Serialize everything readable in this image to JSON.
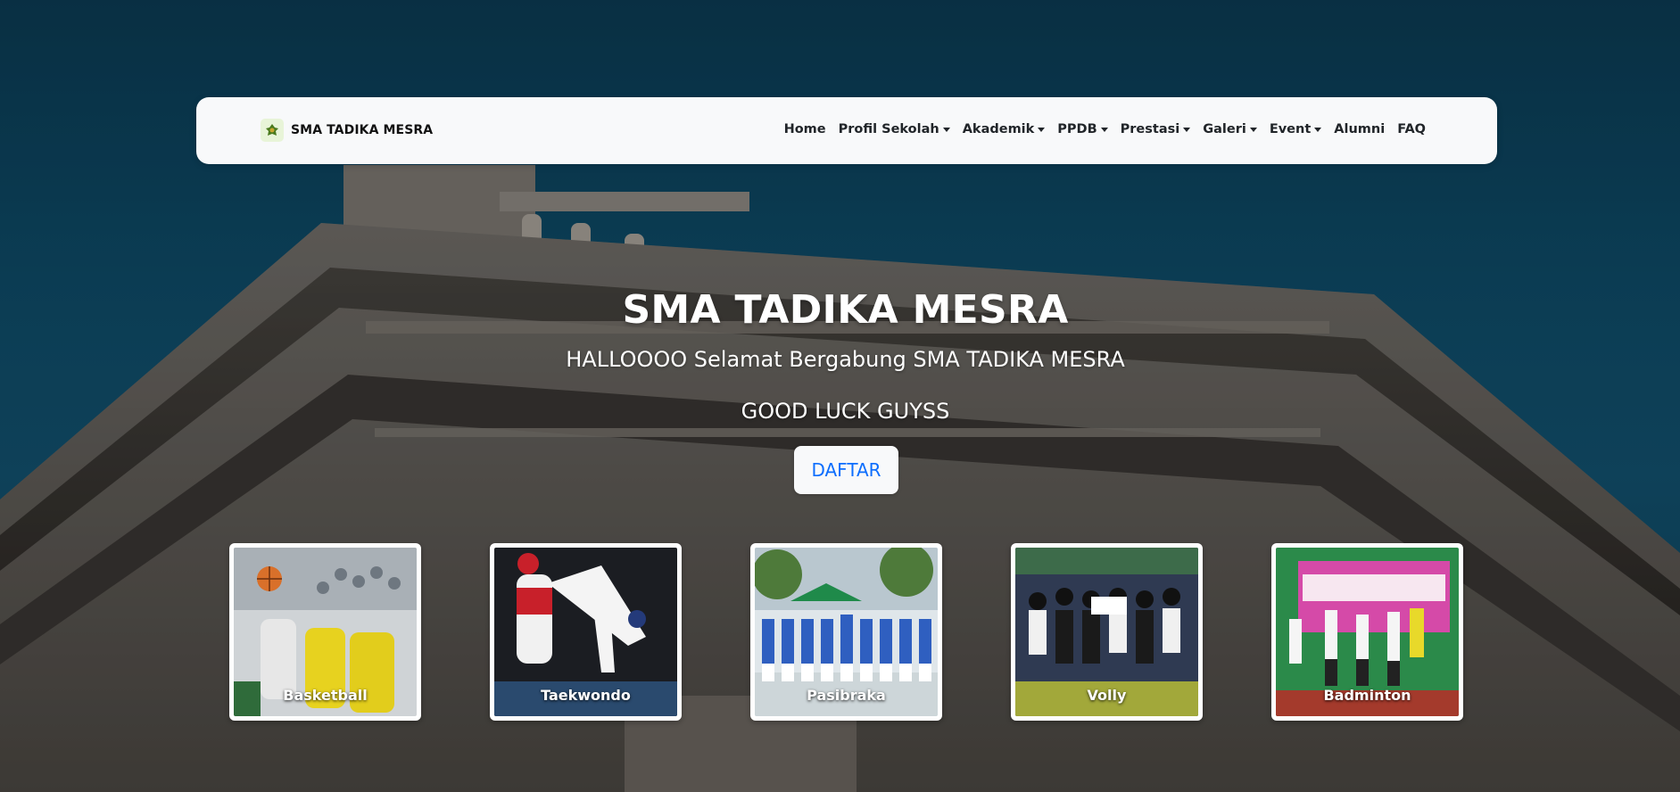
{
  "navbar": {
    "brand_name": "SMA TADIKA MESRA",
    "items": [
      {
        "label": "Home",
        "dropdown": false
      },
      {
        "label": "Profil Sekolah",
        "dropdown": true
      },
      {
        "label": "Akademik",
        "dropdown": true
      },
      {
        "label": "PPDB",
        "dropdown": true
      },
      {
        "label": "Prestasi",
        "dropdown": true
      },
      {
        "label": "Galeri",
        "dropdown": true
      },
      {
        "label": "Event",
        "dropdown": true
      },
      {
        "label": "Alumni",
        "dropdown": false
      },
      {
        "label": "FAQ",
        "dropdown": false
      }
    ]
  },
  "hero": {
    "title": "SMA TADIKA MESRA",
    "subtitle": "HALLOOOO Selamat Bergabung SMA TADIKA MESRA",
    "subtitle2": "GOOD LUCK GUYSS",
    "button_label": "DAFTAR"
  },
  "cards": [
    {
      "label": "Basketball",
      "icon": "basketball-photo"
    },
    {
      "label": "Taekwondo",
      "icon": "taekwondo-photo"
    },
    {
      "label": "Pasibraka",
      "icon": "pasibraka-photo"
    },
    {
      "label": "Volly",
      "icon": "volleyball-photo"
    },
    {
      "label": "Badminton",
      "icon": "badminton-photo"
    }
  ],
  "colors": {
    "navbar_bg": "#f8f9fa",
    "button_text": "#0d6efd",
    "sky": "#0b3a52"
  }
}
